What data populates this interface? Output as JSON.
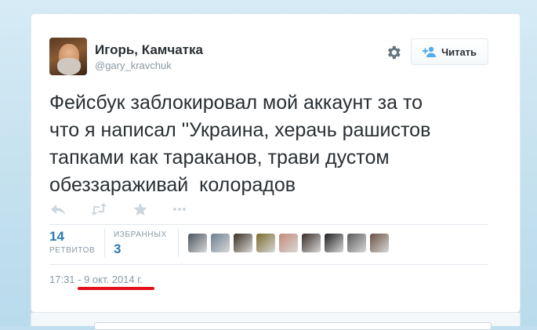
{
  "user": {
    "fullname": "Игорь, Камчатка",
    "handle": "@gary_kravchuk"
  },
  "follow_button": {
    "label": "Читать",
    "icon": "person-plus-icon"
  },
  "settings": {
    "icon": "gear-icon"
  },
  "tweet": {
    "text": "Фейсбук заблокировал мой аккаунт за то\nчто я написал ''Украина, херачь рашистов\nтапками как тараканов, трави дустом\nобеззараживай  колорадов"
  },
  "actions": [
    {
      "name": "reply",
      "icon": "reply-icon"
    },
    {
      "name": "retweet",
      "icon": "retweet-icon"
    },
    {
      "name": "favorite",
      "icon": "star-icon"
    },
    {
      "name": "more",
      "icon": "more-icon"
    }
  ],
  "stats": {
    "retweets_count": "14",
    "retweets_label": "РЕТВИТОВ",
    "favorites_label": "ИЗБРАННЫХ",
    "favorites_count": "3"
  },
  "favoriter_avatars": [
    "#4a5560",
    "#6b7f92",
    "#3c2f1f",
    "#7a6a2a",
    "#c48a76",
    "#3a2c25",
    "#202020",
    "#5a5a5a",
    "#6a5040"
  ],
  "timestamp": "17:31 - 9 окт. 2014 г.",
  "colors": {
    "link": "#2b7bb9",
    "muted": "#8899a6",
    "text": "#292f33",
    "annotation": "#e3101a"
  }
}
